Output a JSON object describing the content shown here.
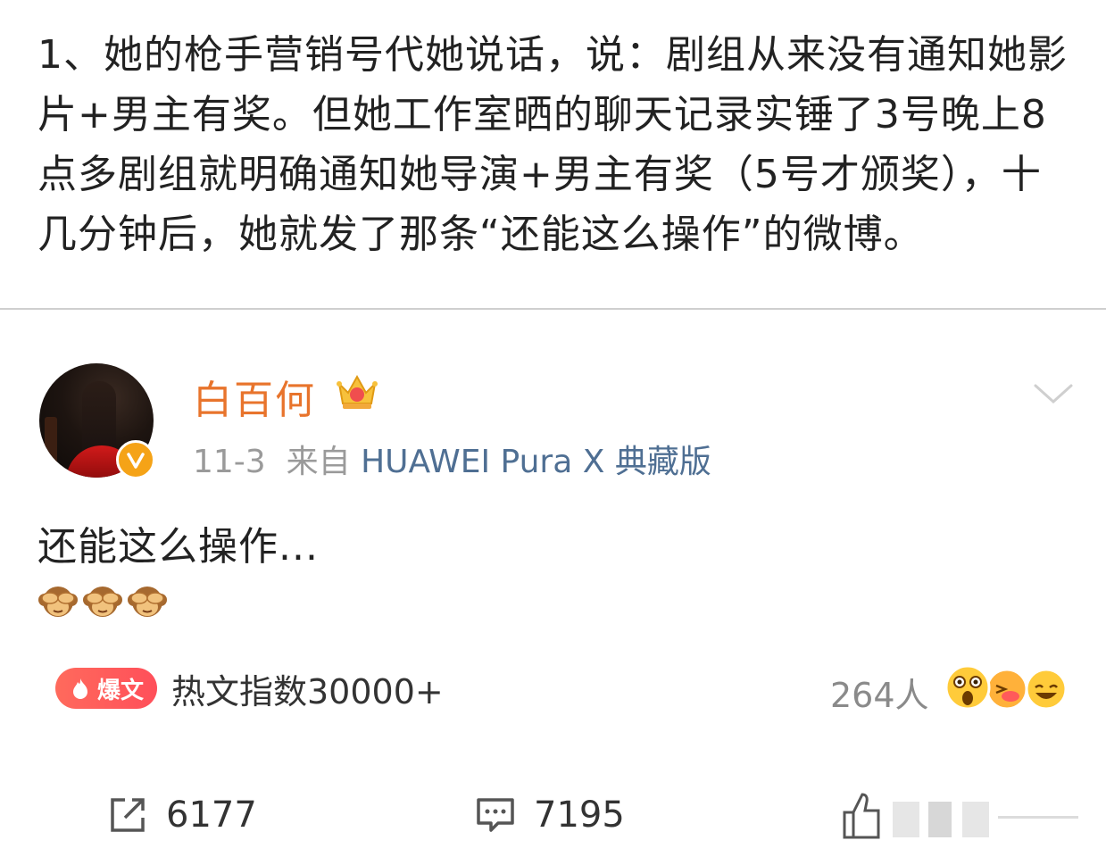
{
  "article": {
    "text": "1、她的枪手营销号代她说话，说：剧组从来没有通知她影片+男主有奖。但她工作室晒的聊天记录实锤了3号晚上8点多剧组就明确通知她导演+男主有奖（5号才颁奖），十几分钟后，她就发了那条“还能这么操作”的微博。"
  },
  "post": {
    "author": "白百何",
    "date": "11-3",
    "source_prefix": "来自",
    "device": "HUAWEI Pura X 典藏版",
    "text": "还能这么操作...",
    "emojis": [
      "monkey-see-no-evil",
      "monkey-see-no-evil",
      "monkey-see-no-evil"
    ]
  },
  "stats": {
    "badge_label": "爆文",
    "hot_index": "热文指数30000+",
    "reactors": "264人",
    "shares": "6177",
    "comments": "7195"
  },
  "colors": {
    "author": "#e8742c",
    "device": "#4f6f93",
    "badge": "#ff5a5a",
    "verified": "#f5a317"
  }
}
